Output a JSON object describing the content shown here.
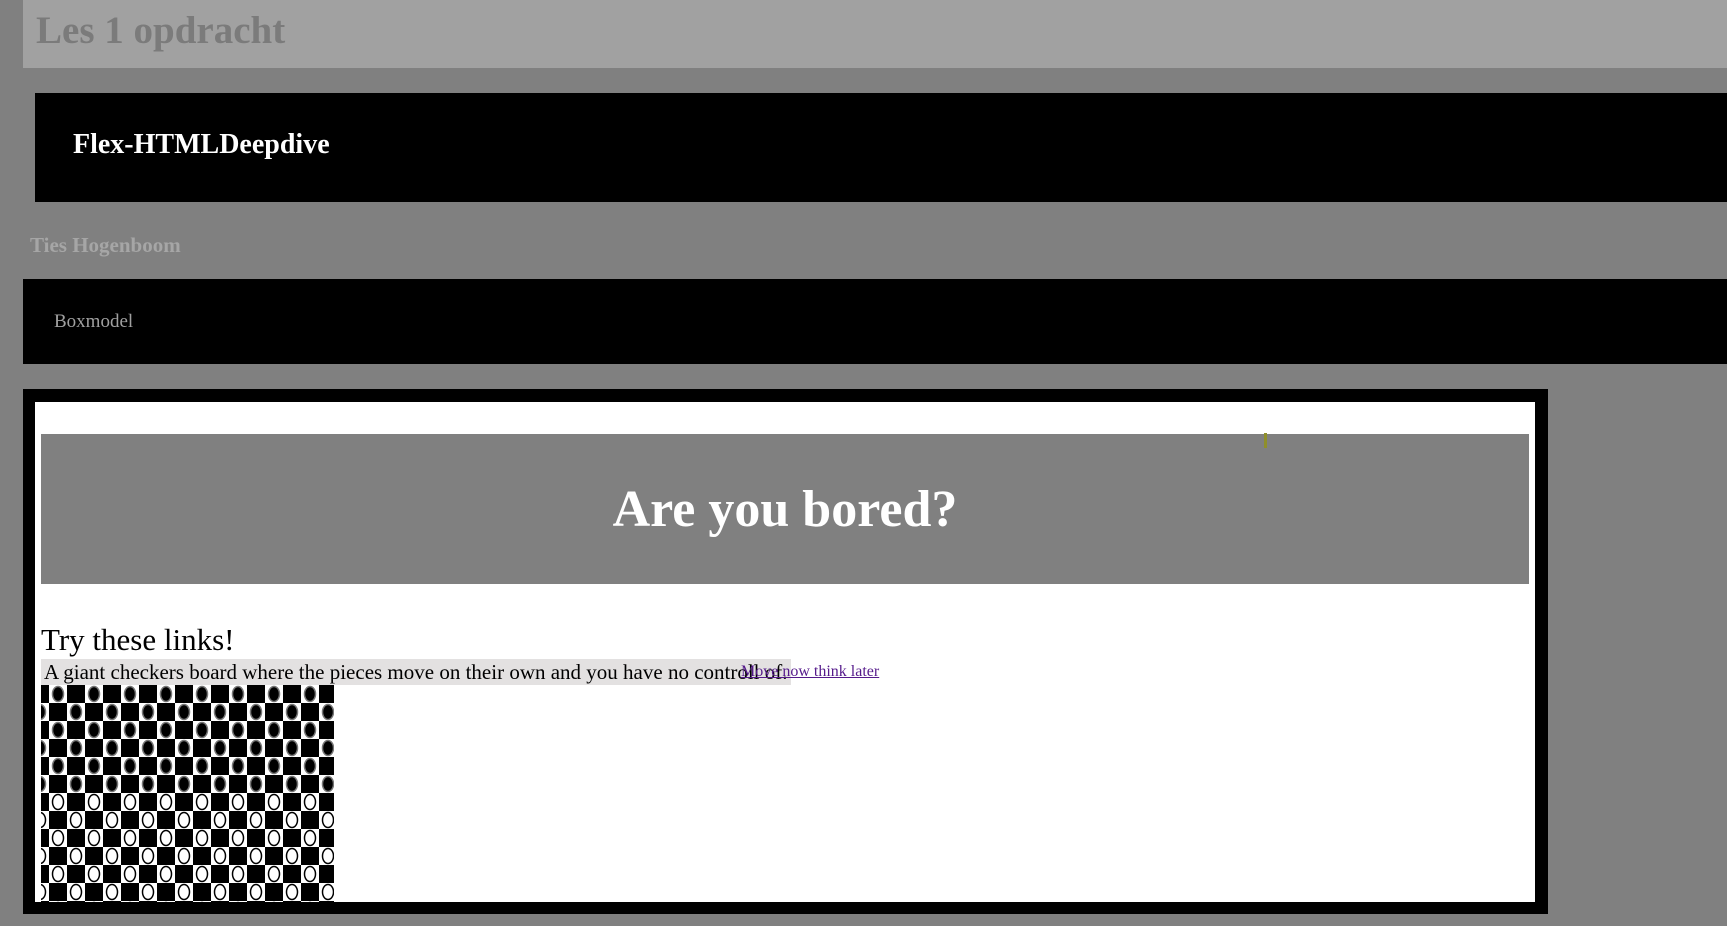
{
  "header": {
    "title": "Les 1 opdracht"
  },
  "project": {
    "title": "Flex-HTMLDeepdive"
  },
  "author": {
    "name": "Ties Hogenboom"
  },
  "nav": {
    "items": [
      {
        "label": "Boxmodel"
      }
    ]
  },
  "embed": {
    "banner_title": "Are you bored?",
    "links_heading": "Try these links!",
    "link_description": "A giant checkers board where the pieces move on their own and you have no controll of.",
    "link_label": "Move now think later"
  },
  "colors": {
    "page_background": "#808080",
    "header_background": "#a1a1a1",
    "bar_background": "#000000",
    "banner_background": "#808080",
    "link_color": "#551a8b"
  }
}
